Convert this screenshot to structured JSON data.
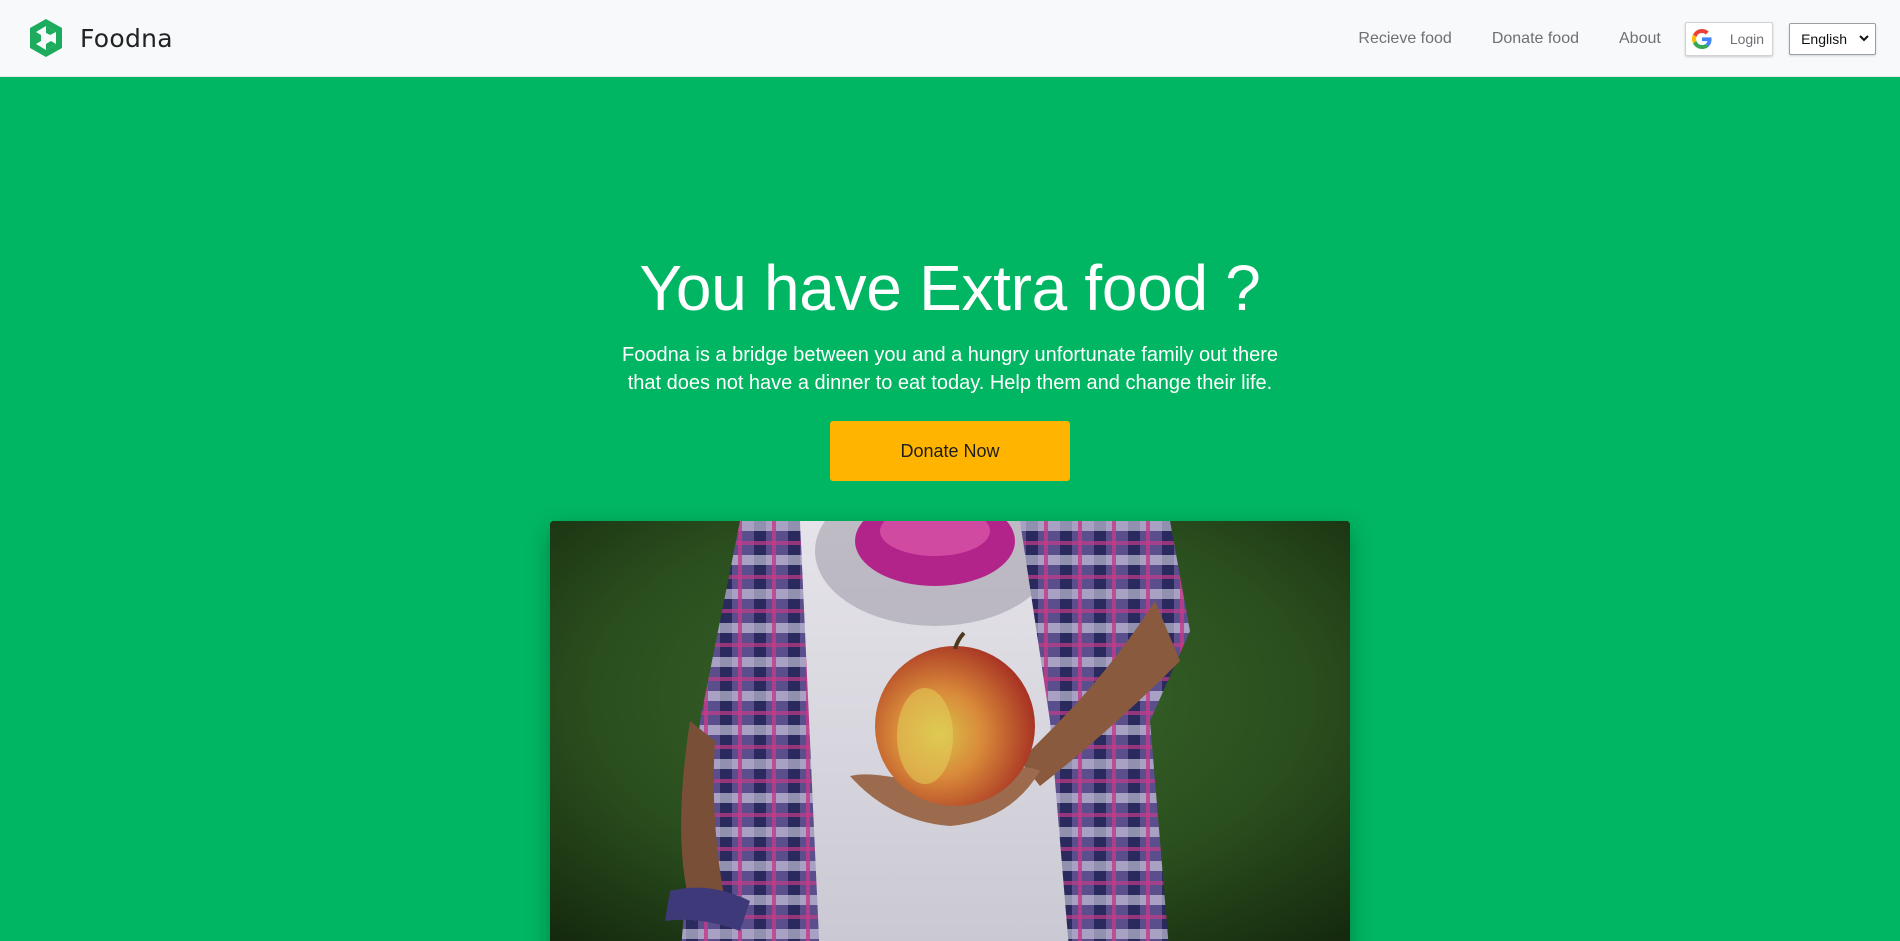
{
  "brand": {
    "name": "Foodna",
    "logo_icon": "hexagon-logo-icon",
    "color": "#00b662"
  },
  "nav": {
    "links": [
      "Recieve food",
      "Donate food",
      "About"
    ],
    "login": {
      "icon": "google-icon",
      "label": "Login"
    },
    "language": {
      "selected": "English",
      "icon": "chevron-down-icon"
    }
  },
  "hero": {
    "title": "You have Extra food ?",
    "subtitle_line1": "Foodna is a bridge between you and a hungry unfortunate family out there",
    "subtitle_line2": "that does not have a dinner to eat today. Help them and change their life.",
    "cta_label": "Donate Now",
    "cta_color": "#ffb400",
    "photo_icon": "child-holding-apple-photo"
  },
  "colors": {
    "background": "#00b662",
    "navbar": "#f8f9fa",
    "nav_text": "#6d7175"
  }
}
